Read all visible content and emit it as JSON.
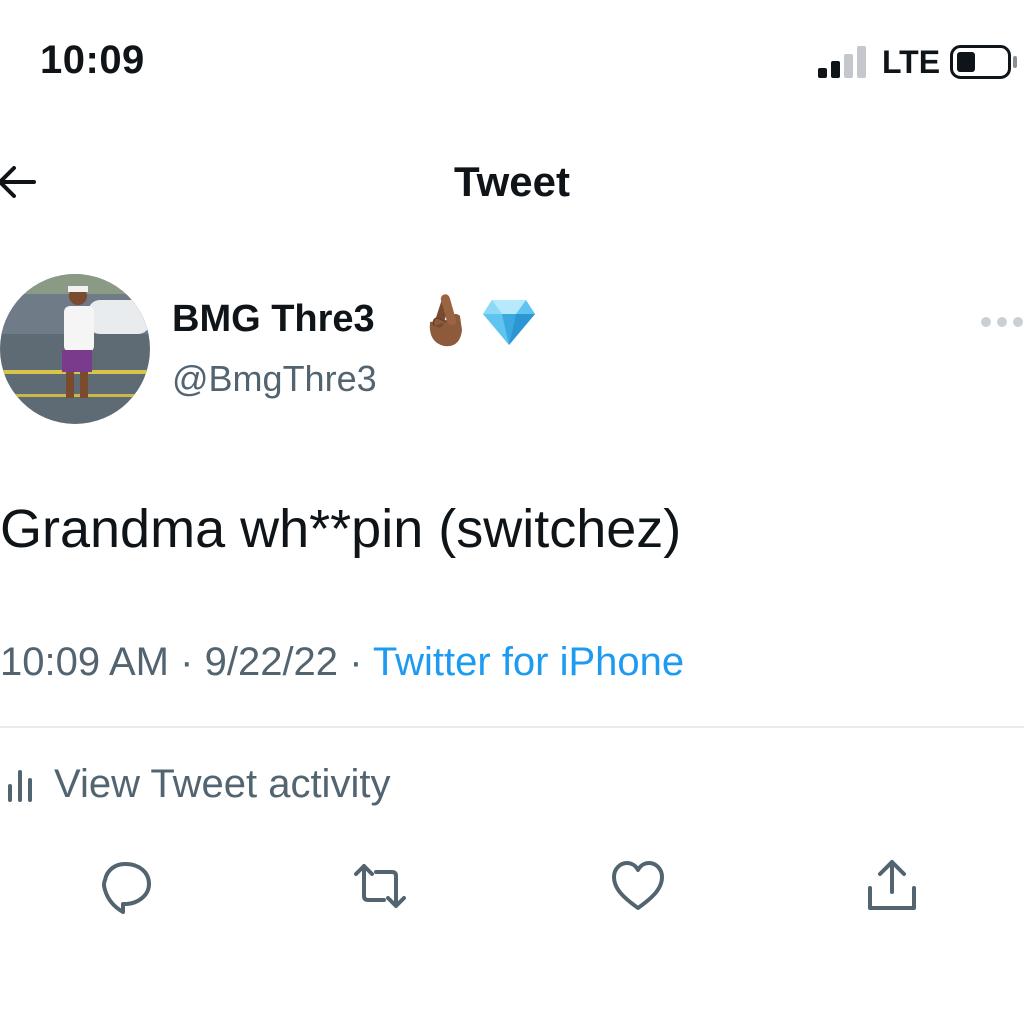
{
  "status_bar": {
    "time": "10:09",
    "network": "LTE",
    "signal_bars_active": 2,
    "signal_bars_total": 4
  },
  "nav": {
    "title": "Tweet",
    "back_icon": "back-arrow-icon"
  },
  "author": {
    "display_name": "BMG Thre3",
    "handle": "@BmgThre3",
    "name_emojis": [
      "crossed-fingers-emoji",
      "gem-emoji"
    ]
  },
  "tweet": {
    "text": "Grandma wh**pin (switchez)",
    "time": "10:09 AM",
    "separator": "·",
    "date": "9/22/22",
    "source": "Twitter for iPhone"
  },
  "activity": {
    "label": "View Tweet activity",
    "icon": "analytics-icon"
  },
  "actions": [
    "reply-icon",
    "retweet-icon",
    "like-icon",
    "share-icon"
  ],
  "colors": {
    "text": "#0f1419",
    "secondary": "#536471",
    "link": "#1d9bf0",
    "divider": "#e6ecf0",
    "background": "#ffffff"
  }
}
